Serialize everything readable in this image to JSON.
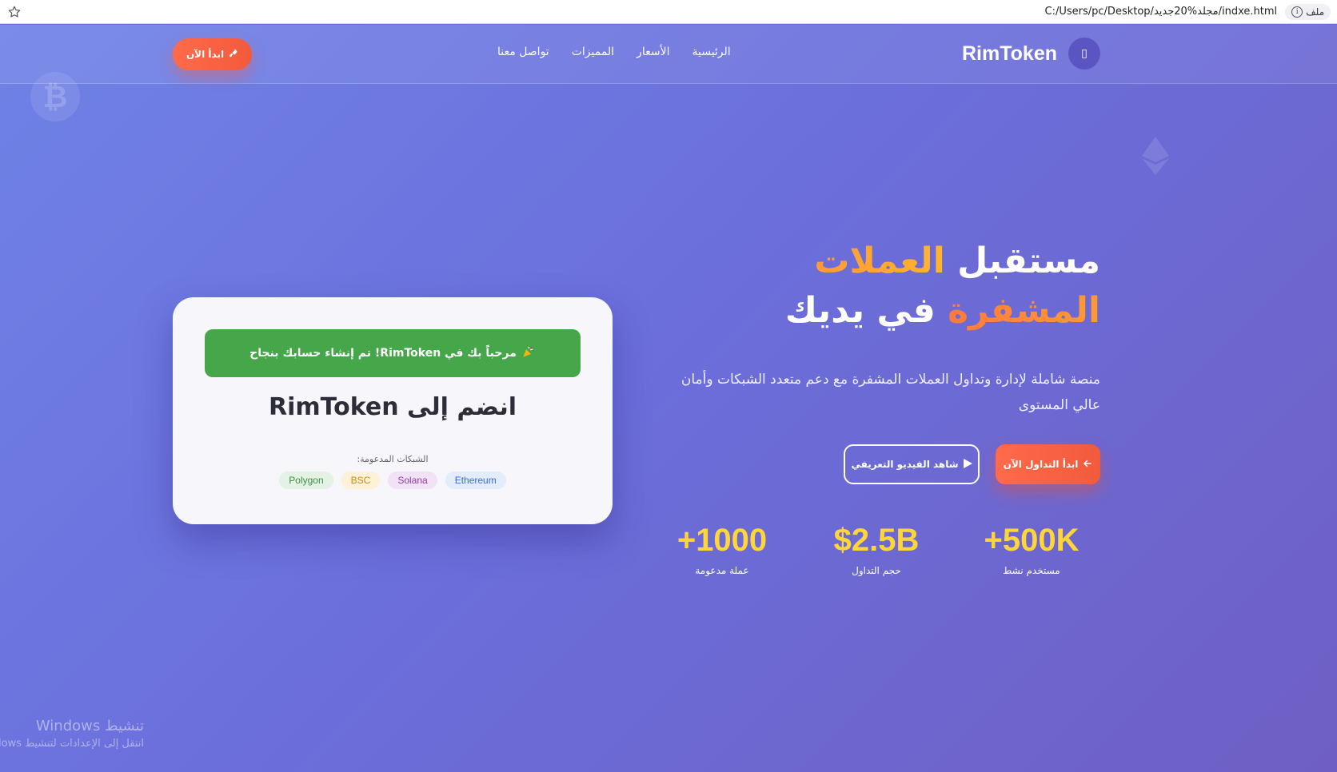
{
  "browser": {
    "url": "C:/Users/pc/Desktop/مجلد%20جديد/indxe.html",
    "file_label": "ملف"
  },
  "nav": {
    "brand": "RimToken",
    "brand_logo_glyph": "▯",
    "links": [
      "الرئيسية",
      "الأسعار",
      "المميزات",
      "تواصل معنا"
    ],
    "cta": "ابدأ الآن"
  },
  "hero": {
    "title_part1": "مستقبل",
    "title_highlight": "العملات المشفرة",
    "title_part2": "في يديك",
    "description": "منصة شاملة لإدارة وتداول العملات المشفرة مع دعم متعدد الشبكات وأمان عالي المستوى",
    "primary_button": "ابدأ التداول الآن",
    "secondary_button": "شاهد الفيديو التعريفي",
    "stats": [
      {
        "value": "+500K",
        "label": "مستخدم نشط"
      },
      {
        "value": "$2.5B",
        "label": "حجم التداول"
      },
      {
        "value": "+1000",
        "label": "عملة مدعومة"
      }
    ]
  },
  "card": {
    "success_message": "مرحباً بك في RimToken! تم إنشاء حسابك بنجاح",
    "title": "انضم إلى RimToken",
    "networks_label": "الشبكات المدعومة:",
    "networks": [
      "Ethereum",
      "Solana",
      "BSC",
      "Polygon"
    ]
  },
  "watermark": {
    "title": "تنشيط Windows",
    "subtitle": "انتقل إلى الإعدادات لتنشيط Windows"
  },
  "colors": {
    "accent_orange": "#f25a3c",
    "stat_yellow": "#ffd63a",
    "success_green": "#45a64a"
  }
}
